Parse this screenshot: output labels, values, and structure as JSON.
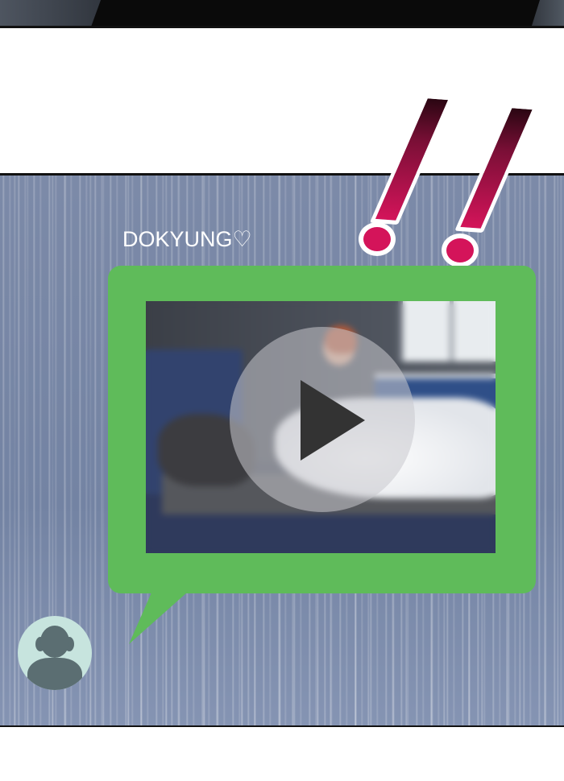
{
  "chat": {
    "sender_name": "DOKYUNG♡",
    "message_type": "video",
    "play_icon": "play-icon",
    "avatar_icon": "person-silhouette-icon"
  },
  "effects": {
    "exclamation_marks": 2,
    "exclamation_color": "#d4145a"
  },
  "colors": {
    "panel_background": "#7c8aa8",
    "bubble_green": "#5fbb5a",
    "avatar_background": "#c7e4de"
  }
}
